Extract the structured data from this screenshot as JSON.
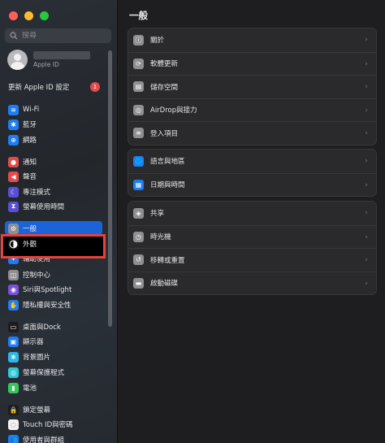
{
  "sidebar": {
    "search_placeholder": "搜尋",
    "account_subtitle": "Apple ID",
    "update": {
      "label": "更新 Apple ID 設定",
      "badge": "1"
    },
    "items": [
      {
        "label": "Wi-Fi",
        "icon": "wifi-icon",
        "color": "#1d7df2"
      },
      {
        "label": "藍牙",
        "icon": "bluetooth-icon",
        "color": "#1d7df2"
      },
      {
        "label": "網路",
        "icon": "globe-icon",
        "color": "#1d7df2"
      },
      {
        "label": "通知",
        "icon": "notification-icon",
        "color": "#e5494c"
      },
      {
        "label": "聲音",
        "icon": "speaker-icon",
        "color": "#e5494c"
      },
      {
        "label": "專注模式",
        "icon": "moon-icon",
        "color": "#5b4fd8"
      },
      {
        "label": "螢幕使用時間",
        "icon": "hourglass-icon",
        "color": "#5b4fd8"
      },
      {
        "label": "一般",
        "icon": "gear-icon",
        "color": "#8e8e93"
      },
      {
        "label": "外觀",
        "icon": "appearance-icon",
        "color": "#1c1c1e"
      },
      {
        "label": "輔助使用",
        "icon": "accessibility-icon",
        "color": "#1d7df2"
      },
      {
        "label": "控制中心",
        "icon": "control-center-icon",
        "color": "#8e8e93"
      },
      {
        "label": "Siri與Spotlight",
        "icon": "siri-icon",
        "color": "#7b4fd8"
      },
      {
        "label": "隱私權與安全性",
        "icon": "hand-icon",
        "color": "#1d7df2"
      },
      {
        "label": "桌面與Dock",
        "icon": "dock-icon",
        "color": "#1c1c1e"
      },
      {
        "label": "顯示器",
        "icon": "display-icon",
        "color": "#1d7df2"
      },
      {
        "label": "背景圖片",
        "icon": "wallpaper-icon",
        "color": "#2fb4e8"
      },
      {
        "label": "螢幕保護程式",
        "icon": "screensaver-icon",
        "color": "#2fc7d8"
      },
      {
        "label": "電池",
        "icon": "battery-icon",
        "color": "#34c759"
      },
      {
        "label": "鎖定螢幕",
        "icon": "lock-icon",
        "color": "#1c1c1e"
      },
      {
        "label": "Touch ID與密碼",
        "icon": "fingerprint-icon",
        "color": "#f2f2f2"
      },
      {
        "label": "使用者與群組",
        "icon": "users-icon",
        "color": "#1d7df2"
      }
    ]
  },
  "main": {
    "title": "一般",
    "groups": [
      [
        {
          "label": "關於",
          "icon": "info-icon",
          "color": "#8e8e93"
        },
        {
          "label": "軟體更新",
          "icon": "software-update-icon",
          "color": "#8e8e93"
        },
        {
          "label": "儲存空間",
          "icon": "storage-icon",
          "color": "#8e8e93"
        },
        {
          "label": "AirDrop與接力",
          "icon": "airdrop-icon",
          "color": "#8e8e93"
        },
        {
          "label": "登入項目",
          "icon": "login-items-icon",
          "color": "#8e8e93"
        }
      ],
      [
        {
          "label": "語言與地區",
          "icon": "language-globe-icon",
          "color": "#1d7df2"
        },
        {
          "label": "日期與時間",
          "icon": "calendar-icon",
          "color": "#1d7df2"
        }
      ],
      [
        {
          "label": "共享",
          "icon": "sharing-icon",
          "color": "#8e8e93"
        },
        {
          "label": "時光機",
          "icon": "time-machine-icon",
          "color": "#8e8e93"
        },
        {
          "label": "移轉或重置",
          "icon": "reset-icon",
          "color": "#8e8e93"
        },
        {
          "label": "啟動磁碟",
          "icon": "startup-disk-icon",
          "color": "#8e8e93"
        }
      ]
    ]
  }
}
